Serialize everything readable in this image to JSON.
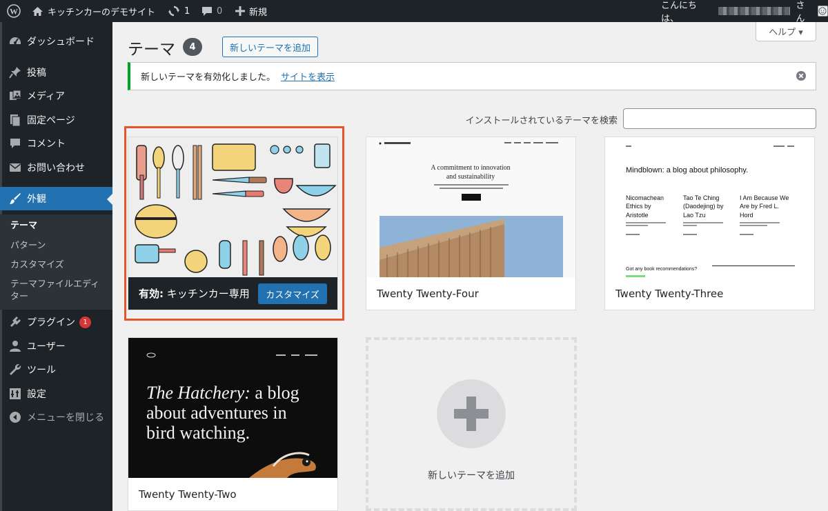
{
  "adminbar": {
    "site_name": "キッチンカーのデモサイト",
    "updates_count": "1",
    "comments_count": "0",
    "new_label": "新規",
    "greeting": "こんにちは、",
    "greeting_suffix": "さん"
  },
  "sidebar": {
    "items": [
      {
        "label": "ダッシュボード",
        "icon": "dashboard-icon"
      },
      {
        "label": "投稿",
        "icon": "pin-icon"
      },
      {
        "label": "メディア",
        "icon": "media-icon"
      },
      {
        "label": "固定ページ",
        "icon": "page-icon"
      },
      {
        "label": "コメント",
        "icon": "comment-icon"
      },
      {
        "label": "お問い合わせ",
        "icon": "mail-icon"
      },
      {
        "label": "外観",
        "icon": "brush-icon"
      },
      {
        "label": "プラグイン",
        "icon": "plugin-icon",
        "badge": "1"
      },
      {
        "label": "ユーザー",
        "icon": "user-icon"
      },
      {
        "label": "ツール",
        "icon": "wrench-icon"
      },
      {
        "label": "設定",
        "icon": "settings-icon"
      },
      {
        "label": "メニューを閉じる",
        "icon": "collapse-icon"
      }
    ],
    "submenu": [
      "テーマ",
      "パターン",
      "カスタマイズ",
      "テーマファイルエディ",
      "ター"
    ]
  },
  "help_label": "ヘルプ ▾",
  "page": {
    "title": "テーマ",
    "count": "4",
    "add_new_label": "新しいテーマを追加"
  },
  "notice": {
    "message": "新しいテーマを有効化しました。",
    "link_label": "サイトを表示"
  },
  "search": {
    "label": "インストールされているテーマを検索",
    "value": ""
  },
  "themes": {
    "active": {
      "active_prefix": "有効:",
      "name": " キッチンカー専用...",
      "customize_label": "カスタマイズ"
    },
    "t24": {
      "name": "Twenty Twenty-Four",
      "headline1": "A commitment to innovation",
      "headline2": "and sustainability"
    },
    "t23": {
      "name": "Twenty Twenty-Three",
      "headline": "Mindblown: a blog about philosophy.",
      "col1": "Nicomachean Ethics by Aristotle",
      "col2": "Tao Te Ching (Daodejing) by Lao Tzu",
      "col3": "I Am Because We Are by Fred L. Hord",
      "footer": "Got any book recommendations?"
    },
    "t22": {
      "name": "Twenty Twenty-Two",
      "headline_italic": "The Hatchery:",
      "headline_rest": " a blog about adventures in bird watching."
    }
  },
  "add_theme_label": "新しいテーマを追加"
}
